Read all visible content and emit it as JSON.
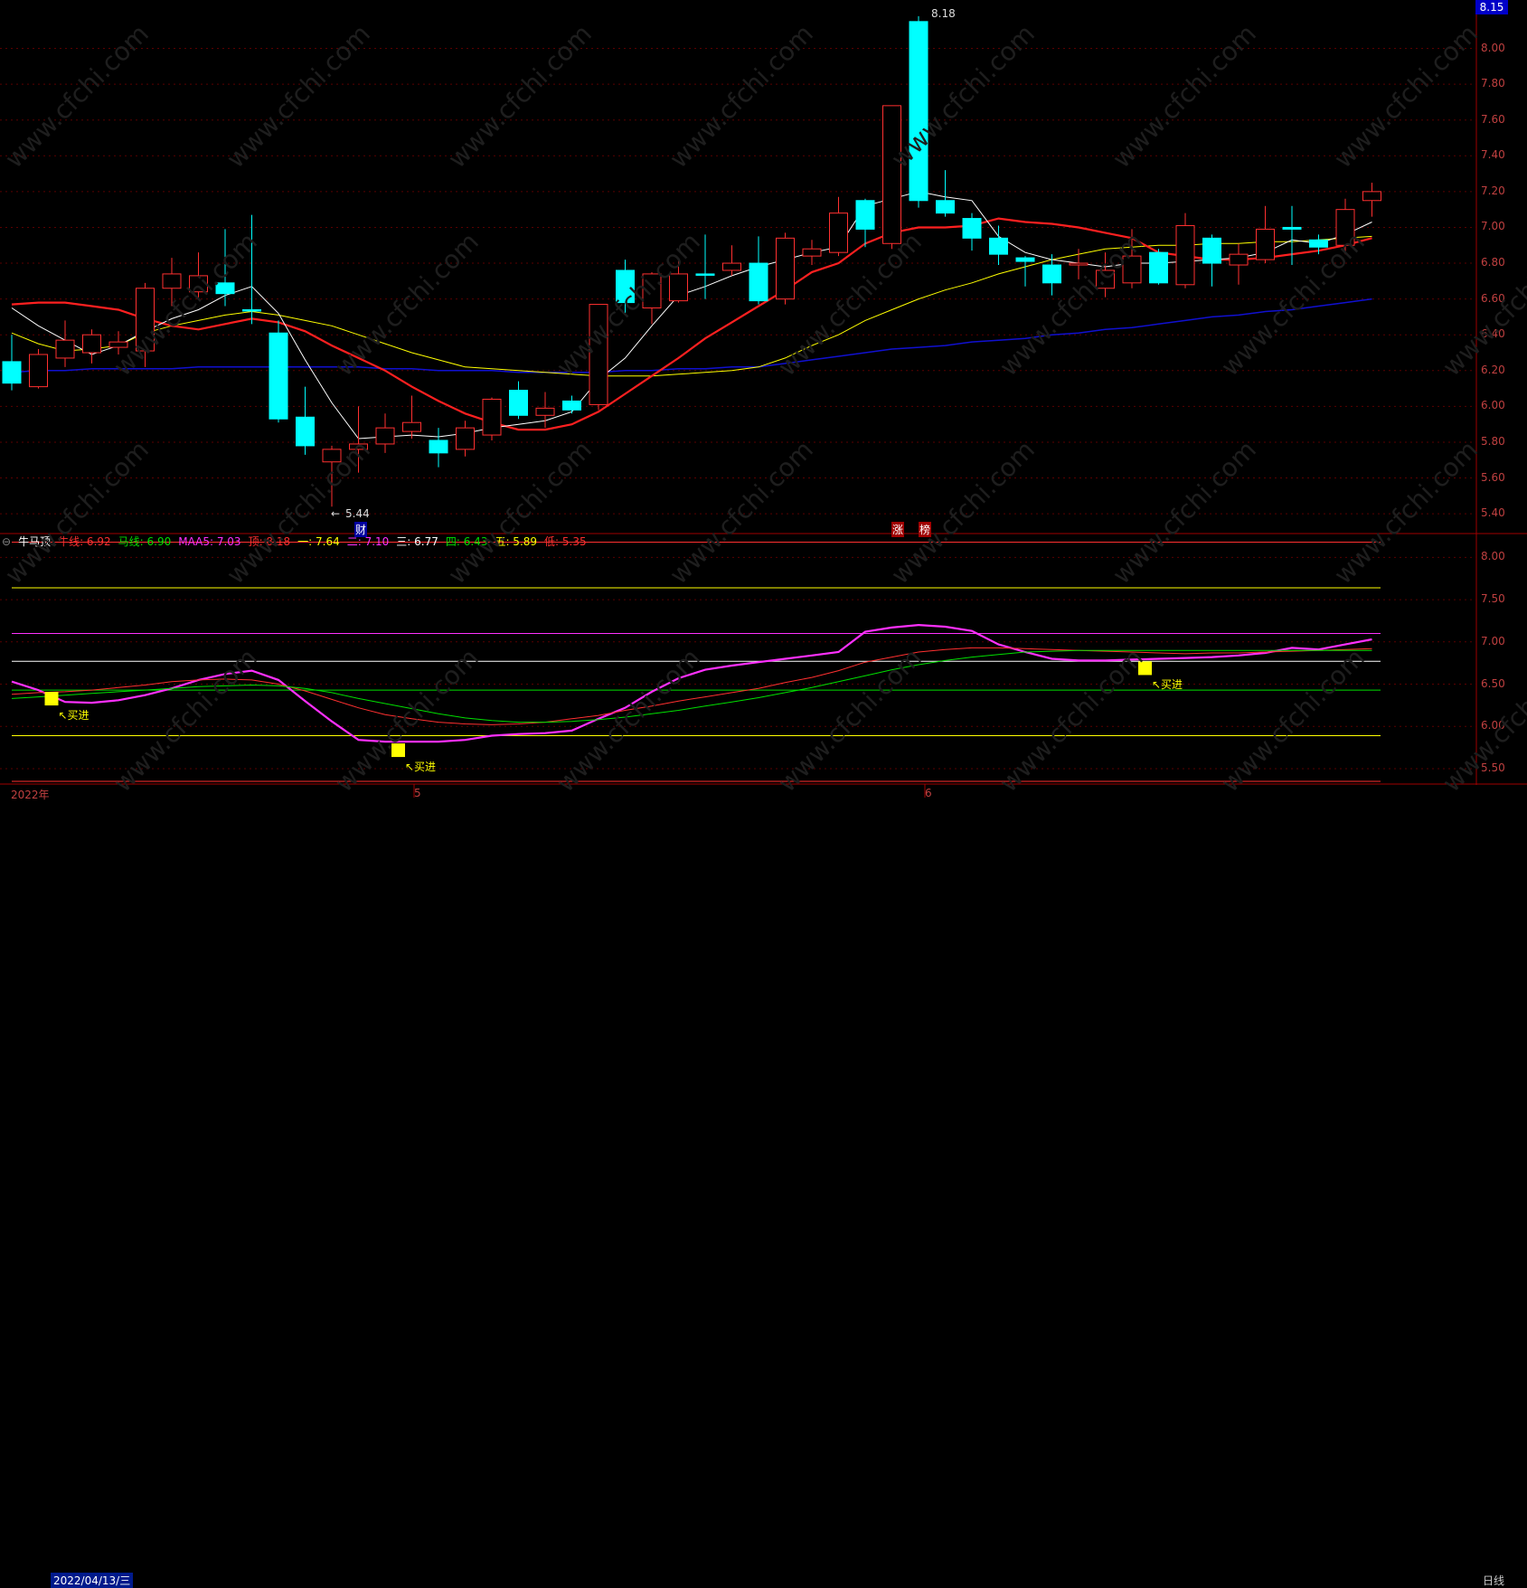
{
  "watermark": "www.cfchi.com",
  "price_tag": "8.15",
  "high_label": "8.18",
  "low_label": "5.44",
  "markers": {
    "cai": "财",
    "zhang": "涨",
    "bang": "榜"
  },
  "period": "日线",
  "footer": {
    "year": "2022年",
    "date": "2022/04/13/三",
    "month5": "5",
    "month6": "6"
  },
  "indicator": {
    "name": "牛马顶",
    "items": [
      {
        "label": "牛线:",
        "value": "6.92",
        "color": "#ff3030"
      },
      {
        "label": "马线:",
        "value": "6.90",
        "color": "#00e000"
      },
      {
        "label": "MAA5:",
        "value": "7.03",
        "color": "#ff30ff"
      },
      {
        "label": "顶:",
        "value": "8.18",
        "color": "#ff3030"
      },
      {
        "label": "一:",
        "value": "7.64",
        "color": "#ffff00"
      },
      {
        "label": "二:",
        "value": "7.10",
        "color": "#ff30ff"
      },
      {
        "label": "三:",
        "value": "6.77",
        "color": "#ffffff"
      },
      {
        "label": "四:",
        "value": "6.43",
        "color": "#00e000"
      },
      {
        "label": "五:",
        "value": "5.89",
        "color": "#ffff00"
      },
      {
        "label": "低:",
        "value": "5.35",
        "color": "#ff3030"
      }
    ],
    "buy_label": "买进"
  },
  "chart_data": [
    {
      "type": "candlestick",
      "ylim": [
        5.33,
        8.23
      ],
      "y_ticks": [
        "8.00",
        "7.80",
        "7.60",
        "7.40",
        "7.20",
        "7.00",
        "6.80",
        "6.60",
        "6.40",
        "6.20",
        "6.00",
        "5.80",
        "5.60",
        "5.40"
      ],
      "colors": {
        "up": "#ff3030",
        "down": "#00ffff",
        "ma_white": "#ffffff",
        "ma_yellow": "#ffff00",
        "ma_red": "#ff2020",
        "ma_blue": "#1010d0"
      },
      "candles": [
        [
          6.25,
          6.13,
          6.4,
          6.09
        ],
        [
          6.11,
          6.29,
          6.32,
          6.1
        ],
        [
          6.27,
          6.37,
          6.48,
          6.22
        ],
        [
          6.3,
          6.4,
          6.43,
          6.24
        ],
        [
          6.33,
          6.36,
          6.42,
          6.29
        ],
        [
          6.31,
          6.66,
          6.69,
          6.22
        ],
        [
          6.66,
          6.74,
          6.83,
          6.56
        ],
        [
          6.64,
          6.73,
          6.86,
          6.6
        ],
        [
          6.69,
          6.63,
          6.99,
          6.56
        ],
        [
          6.54,
          6.54,
          7.07,
          6.46
        ],
        [
          6.41,
          5.93,
          6.48,
          5.91
        ],
        [
          5.94,
          5.78,
          6.11,
          5.73
        ],
        [
          5.69,
          5.76,
          5.78,
          5.44
        ],
        [
          5.76,
          5.79,
          6.0,
          5.63
        ],
        [
          5.79,
          5.88,
          5.96,
          5.74
        ],
        [
          5.86,
          5.91,
          6.06,
          5.82
        ],
        [
          5.81,
          5.74,
          5.88,
          5.66
        ],
        [
          5.76,
          5.88,
          5.92,
          5.72
        ],
        [
          5.84,
          6.04,
          6.05,
          5.81
        ],
        [
          6.09,
          5.95,
          6.14,
          5.93
        ],
        [
          5.95,
          5.99,
          6.08,
          5.88
        ],
        [
          6.03,
          5.98,
          6.06,
          5.96
        ],
        [
          6.01,
          6.57,
          6.57,
          5.98
        ],
        [
          6.76,
          6.58,
          6.82,
          6.52
        ],
        [
          6.55,
          6.74,
          6.75,
          6.46
        ],
        [
          6.59,
          6.74,
          6.83,
          6.58
        ],
        [
          6.74,
          6.74,
          6.96,
          6.6
        ],
        [
          6.76,
          6.8,
          6.9,
          6.73
        ],
        [
          6.8,
          6.59,
          6.95,
          6.57
        ],
        [
          6.6,
          6.94,
          6.97,
          6.57
        ],
        [
          6.84,
          6.88,
          6.93,
          6.79
        ],
        [
          6.86,
          7.08,
          7.17,
          6.84
        ],
        [
          7.15,
          6.99,
          7.16,
          6.89
        ],
        [
          6.91,
          7.68,
          7.68,
          6.88
        ],
        [
          8.15,
          7.15,
          8.18,
          7.11
        ],
        [
          7.15,
          7.08,
          7.32,
          7.06
        ],
        [
          7.05,
          6.94,
          7.08,
          6.87
        ],
        [
          6.94,
          6.85,
          7.01,
          6.79
        ],
        [
          6.83,
          6.81,
          6.84,
          6.67
        ],
        [
          6.79,
          6.69,
          6.85,
          6.62
        ],
        [
          6.79,
          6.8,
          6.88,
          6.71
        ],
        [
          6.66,
          6.76,
          6.86,
          6.61
        ],
        [
          6.69,
          6.84,
          6.99,
          6.66
        ],
        [
          6.86,
          6.69,
          6.88,
          6.68
        ],
        [
          6.68,
          7.01,
          7.08,
          6.66
        ],
        [
          6.94,
          6.8,
          6.96,
          6.67
        ],
        [
          6.79,
          6.85,
          6.91,
          6.68
        ],
        [
          6.82,
          6.99,
          7.12,
          6.8
        ],
        [
          7.0,
          6.99,
          7.12,
          6.79
        ],
        [
          6.93,
          6.89,
          6.96,
          6.85
        ],
        [
          6.9,
          7.1,
          7.16,
          6.85
        ],
        [
          7.15,
          7.2,
          7.25,
          7.06
        ]
      ],
      "ma_white": [
        6.55,
        6.45,
        6.37,
        6.29,
        6.34,
        6.42,
        6.49,
        6.54,
        6.62,
        6.67,
        6.52,
        6.26,
        6.02,
        5.82,
        5.83,
        5.84,
        5.83,
        5.85,
        5.88,
        5.9,
        5.92,
        5.97,
        6.15,
        6.27,
        6.45,
        6.62,
        6.67,
        6.73,
        6.78,
        6.82,
        6.86,
        6.89,
        7.12,
        7.16,
        7.2,
        7.17,
        7.15,
        6.95,
        6.86,
        6.82,
        6.8,
        6.78,
        6.8,
        6.8,
        6.81,
        6.82,
        6.83,
        6.86,
        6.93,
        6.91,
        6.96,
        7.03
      ],
      "ma_yellow": [
        6.41,
        6.35,
        6.31,
        6.32,
        6.34,
        6.41,
        6.45,
        6.48,
        6.51,
        6.53,
        6.51,
        6.48,
        6.45,
        6.4,
        6.35,
        6.3,
        6.26,
        6.22,
        6.21,
        6.2,
        6.19,
        6.18,
        6.17,
        6.17,
        6.17,
        6.18,
        6.19,
        6.2,
        6.22,
        6.27,
        6.34,
        6.4,
        6.48,
        6.54,
        6.6,
        6.65,
        6.69,
        6.74,
        6.78,
        6.82,
        6.85,
        6.88,
        6.89,
        6.9,
        6.9,
        6.91,
        6.91,
        6.92,
        6.92,
        6.93,
        6.94,
        6.95
      ],
      "ma_red": [
        6.57,
        6.58,
        6.58,
        6.56,
        6.54,
        6.49,
        6.45,
        6.43,
        6.46,
        6.49,
        6.47,
        6.42,
        6.34,
        6.27,
        6.2,
        6.11,
        6.03,
        5.96,
        5.91,
        5.87,
        5.87,
        5.9,
        5.97,
        6.07,
        6.17,
        6.27,
        6.38,
        6.47,
        6.56,
        6.65,
        6.75,
        6.8,
        6.91,
        6.97,
        7.0,
        7.0,
        7.01,
        7.05,
        7.03,
        7.02,
        7.0,
        6.97,
        6.94,
        6.86,
        6.84,
        6.82,
        6.82,
        6.83,
        6.85,
        6.87,
        6.9,
        6.94
      ],
      "ma_blue": [
        6.19,
        6.2,
        6.2,
        6.21,
        6.21,
        6.21,
        6.21,
        6.22,
        6.22,
        6.22,
        6.22,
        6.22,
        6.22,
        6.22,
        6.21,
        6.21,
        6.2,
        6.2,
        6.2,
        6.19,
        6.19,
        6.19,
        6.19,
        6.2,
        6.2,
        6.21,
        6.21,
        6.22,
        6.22,
        6.24,
        6.26,
        6.28,
        6.3,
        6.32,
        6.33,
        6.34,
        6.36,
        6.37,
        6.38,
        6.4,
        6.41,
        6.43,
        6.44,
        6.46,
        6.48,
        6.5,
        6.51,
        6.53,
        6.54,
        6.56,
        6.58,
        6.6
      ]
    },
    {
      "type": "line",
      "ylim": [
        5.35,
        8.25
      ],
      "y_ticks": [
        "8.00",
        "7.50",
        "7.00",
        "6.50",
        "6.00",
        "5.50"
      ],
      "levels": [
        {
          "name": "顶",
          "value": 8.18,
          "color": "#ff3030"
        },
        {
          "name": "一",
          "value": 7.64,
          "color": "#ffff00"
        },
        {
          "name": "二",
          "value": 7.1,
          "color": "#ff30ff"
        },
        {
          "name": "三",
          "value": 6.77,
          "color": "#ffffff"
        },
        {
          "name": "四",
          "value": 6.43,
          "color": "#00e000"
        },
        {
          "name": "五",
          "value": 5.89,
          "color": "#ffff00"
        },
        {
          "name": "低",
          "value": 5.35,
          "color": "#ff3030"
        }
      ],
      "series": [
        {
          "name": "MAA5",
          "color": "#ff30ff",
          "values": [
            6.53,
            6.43,
            6.29,
            6.28,
            6.31,
            6.37,
            6.45,
            6.55,
            6.62,
            6.66,
            6.55,
            6.3,
            6.06,
            5.84,
            5.82,
            5.82,
            5.82,
            5.84,
            5.89,
            5.91,
            5.92,
            5.95,
            6.09,
            6.22,
            6.41,
            6.57,
            6.67,
            6.72,
            6.76,
            6.8,
            6.84,
            6.88,
            7.12,
            7.17,
            7.2,
            7.18,
            7.13,
            6.97,
            6.88,
            6.8,
            6.78,
            6.78,
            6.79,
            6.8,
            6.81,
            6.82,
            6.84,
            6.87,
            6.93,
            6.91,
            6.97,
            7.03
          ]
        },
        {
          "name": "牛线",
          "color": "#ff3030",
          "values": [
            6.38,
            6.4,
            6.41,
            6.43,
            6.46,
            6.49,
            6.53,
            6.55,
            6.56,
            6.55,
            6.5,
            6.42,
            6.32,
            6.22,
            6.14,
            6.09,
            6.05,
            6.03,
            6.02,
            6.03,
            6.05,
            6.09,
            6.13,
            6.19,
            6.24,
            6.3,
            6.35,
            6.4,
            6.45,
            6.52,
            6.58,
            6.66,
            6.76,
            6.82,
            6.88,
            6.91,
            6.93,
            6.93,
            6.92,
            6.91,
            6.9,
            6.89,
            6.88,
            6.87,
            6.86,
            6.87,
            6.87,
            6.88,
            6.89,
            6.9,
            6.91,
            6.92
          ]
        },
        {
          "name": "马线",
          "color": "#00e000",
          "values": [
            6.33,
            6.35,
            6.37,
            6.39,
            6.41,
            6.43,
            6.45,
            6.47,
            6.48,
            6.49,
            6.48,
            6.45,
            6.4,
            6.33,
            6.27,
            6.21,
            6.15,
            6.1,
            6.07,
            6.05,
            6.05,
            6.06,
            6.08,
            6.11,
            6.15,
            6.19,
            6.24,
            6.29,
            6.34,
            6.4,
            6.46,
            6.53,
            6.6,
            6.67,
            6.73,
            6.78,
            6.82,
            6.85,
            6.88,
            6.89,
            6.9,
            6.9,
            6.9,
            6.9,
            6.9,
            6.9,
            6.9,
            6.9,
            6.9,
            6.9,
            6.9,
            6.9
          ]
        }
      ],
      "buy_signals": [
        1,
        14,
        42
      ]
    }
  ]
}
